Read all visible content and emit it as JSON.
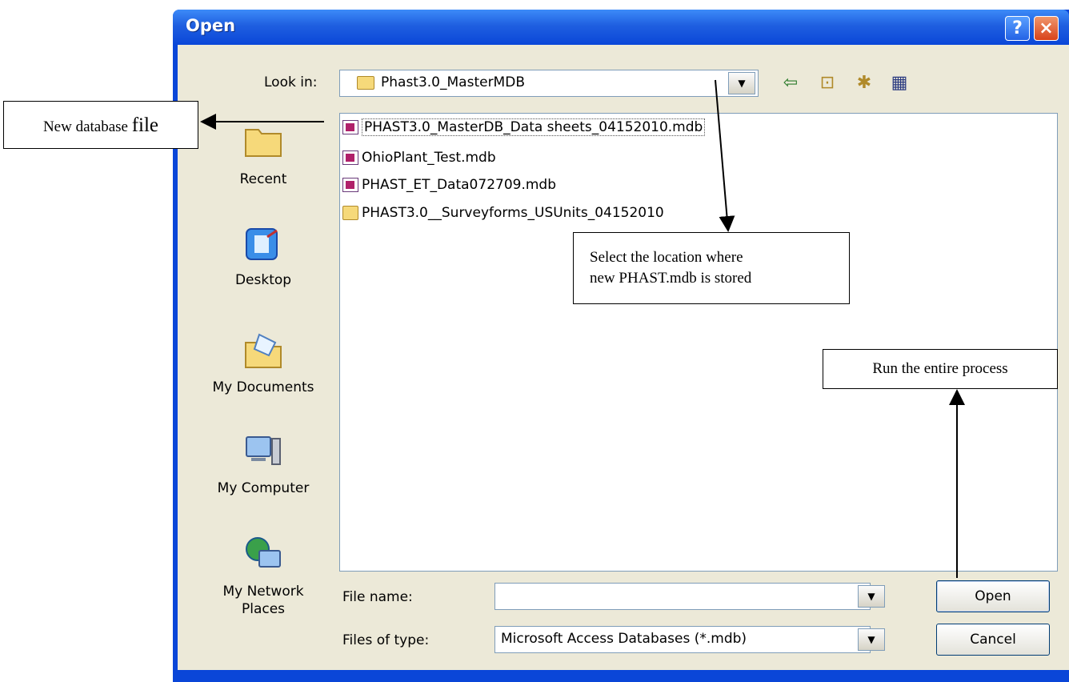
{
  "window": {
    "title": "Open"
  },
  "toolbar": {
    "look_in_label": "Look in:",
    "look_in_value": "Phast3.0_MasterMDB"
  },
  "places": [
    {
      "label": "Recent"
    },
    {
      "label": "Desktop"
    },
    {
      "label": "My Documents"
    },
    {
      "label": "My Computer"
    },
    {
      "label": "My Network Places"
    }
  ],
  "files": [
    {
      "name": "PHAST3.0_MasterDB_Data sheets_04152010.mdb",
      "type": "mdb"
    },
    {
      "name": "OhioPlant_Test.mdb",
      "type": "mdb"
    },
    {
      "name": "PHAST_ET_Data072709.mdb",
      "type": "mdb"
    },
    {
      "name": "PHAST3.0__Surveyforms_USUnits_04152010",
      "type": "folder"
    }
  ],
  "form": {
    "file_name_label": "File name:",
    "file_name_value": "",
    "file_type_label": "Files of type:",
    "file_type_value": "Microsoft Access Databases (*.mdb)"
  },
  "buttons": {
    "open": "Open",
    "cancel": "Cancel",
    "help": "?",
    "close": "×"
  },
  "annotations": {
    "new_db_pre": "New database ",
    "new_db_big": "file",
    "location_line1": "Select the location where",
    "location_line2": "new PHAST.mdb is stored",
    "run": "Run the entire process"
  },
  "icons": {
    "recent": "recent-folder-icon",
    "desktop": "desktop-icon",
    "documents": "my-documents-icon",
    "computer": "my-computer-icon",
    "network": "network-places-icon"
  },
  "colors": {
    "titlebar": "#0a46d8",
    "dialog_bg": "#ece9d8",
    "close": "#d8421a"
  }
}
